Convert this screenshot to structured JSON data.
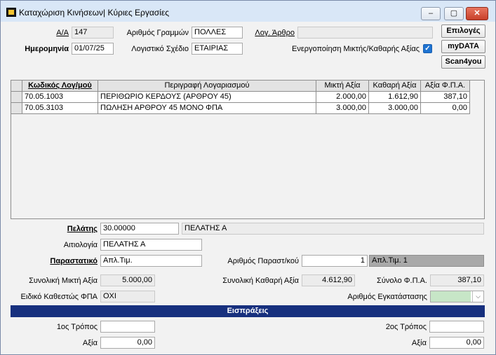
{
  "window": {
    "title": "Καταχώριση Κινήσεων| Κύριες Εργασίες",
    "minimize": "–",
    "maximize": "▢",
    "close": "✕"
  },
  "header": {
    "aa_label": "Α/Α",
    "aa_value": "147",
    "lines_label": "Αριθμός Γραμμών",
    "lines_value": "ΠΟΛΛΕΣ",
    "acc_article_label": "Λογ. Άρθρο",
    "acc_article_value": "",
    "date_label": "Ημερομηνία",
    "date_value": "01/07/25",
    "plan_label": "Λογιστικό Σχέδιο",
    "plan_value": "ΕΤΑΙΡΙΑΣ",
    "gross_net_label": "Ενεργοποίηση Μικτής/Καθαρής Αξίας",
    "gross_net_checked": "✓"
  },
  "buttons": {
    "options": "Επιλογές",
    "mydata": "myDATA",
    "scan4you": "Scan4you"
  },
  "grid": {
    "columns": [
      "Κωδικός Λογ/μού",
      "Περιγραφή Λογαριασμού",
      "Μικτή Αξία",
      "Καθαρή Αξία",
      "Αξία Φ.Π.Α."
    ],
    "rows": [
      [
        "70.05.1003",
        "ΠΕΡΙΘΩΡΙΟ ΚΕΡΔΟΥΣ (ΑΡΘΡΟΥ 45)",
        "2.000,00",
        "1.612,90",
        "387,10"
      ],
      [
        "70.05.3103",
        "ΠΩΛΗΣΗ ΑΡΘΡΟΥ 45 ΜΟΝΟ ΦΠΑ",
        "3.000,00",
        "3.000,00",
        "0,00"
      ]
    ]
  },
  "customer": {
    "label": "Πελάτης",
    "code": "30.00000",
    "name": "ΠΕΛΑΤΗΣ Α"
  },
  "reason": {
    "label": "Αιτιολογία",
    "value": "ΠΕΛΑΤΗΣ Α"
  },
  "document": {
    "label": "Παραστατικό",
    "value": "Απλ.Τιμ.",
    "number_label": "Αριθμός Παραστ/κού",
    "number_value": "1",
    "number_desc": "Απλ.Τιμ. 1"
  },
  "totals": {
    "gross_label": "Συνολική Μικτή Αξία",
    "gross_value": "5.000,00",
    "net_label": "Συνολική Καθαρή Αξία",
    "net_value": "4.612,90",
    "vat_label": "Σύνολο Φ.Π.Α.",
    "vat_value": "387,10"
  },
  "vat_regime": {
    "label": "Ειδικό Καθεστώς ΦΠΑ",
    "value": "ΟΧΙ"
  },
  "installation": {
    "label": "Αριθμός Εγκατάστασης",
    "value": ""
  },
  "receipts": {
    "title": "Εισπράξεις",
    "method1_label": "1ος Τρόπος",
    "method1_value": "",
    "amount1_label": "Αξία",
    "amount1_value": "0,00",
    "method2_label": "2ος Τρόπος",
    "method2_value": "",
    "amount2_label": "Αξία",
    "amount2_value": "0,00"
  }
}
